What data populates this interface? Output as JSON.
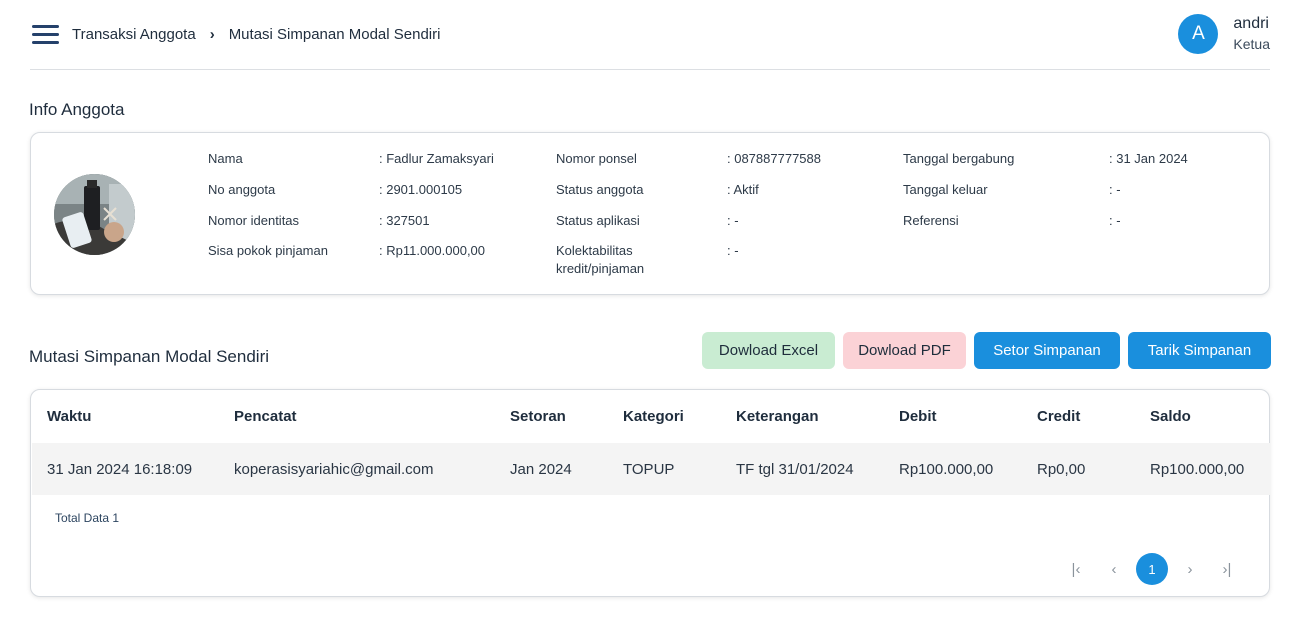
{
  "breadcrumb": {
    "parent": "Transaksi Anggota",
    "current": "Mutasi Simpanan Modal Sendiri"
  },
  "user": {
    "initial": "A",
    "name": "andri",
    "role": "Ketua"
  },
  "info": {
    "title": "Info Anggota",
    "fields": [
      {
        "label": "Nama",
        "value": ": Fadlur Zamaksyari"
      },
      {
        "label": "No anggota",
        "value": ": 2901.000105"
      },
      {
        "label": "Nomor identitas",
        "value": ": 327501"
      },
      {
        "label": "Sisa pokok pinjaman",
        "value": ": Rp11.000.000,00"
      },
      {
        "label": "Nomor ponsel",
        "value": ": 087887777588"
      },
      {
        "label": "Status anggota",
        "value": ": Aktif"
      },
      {
        "label": "Status aplikasi",
        "value": ": -"
      },
      {
        "label": "Kolektabilitas kredit/pinjaman",
        "value": ": -"
      },
      {
        "label": "Tanggal bergabung",
        "value": ": 31 Jan 2024"
      },
      {
        "label": "Tanggal keluar",
        "value": ": -"
      },
      {
        "label": "Referensi",
        "value": ": -"
      }
    ]
  },
  "mutasi": {
    "title": "Mutasi Simpanan Modal Sendiri",
    "buttons": {
      "excel": "Dowload Excel",
      "pdf": "Dowload PDF",
      "setor": "Setor Simpanan",
      "tarik": "Tarik Simpanan"
    },
    "columns": [
      "Waktu",
      "Pencatat",
      "Setoran",
      "Kategori",
      "Keterangan",
      "Debit",
      "Credit",
      "Saldo"
    ],
    "rows": [
      [
        "31 Jan 2024 16:18:09",
        "koperasisyariahic@gmail.com",
        "Jan 2024",
        "TOPUP",
        "TF tgl 31/01/2024",
        "Rp100.000,00",
        "Rp0,00",
        "Rp100.000,00"
      ]
    ],
    "total_label": "Total Data 1",
    "pagination": {
      "first": "|‹",
      "prev": "‹",
      "current": "1",
      "next": "›",
      "last": "›|"
    }
  },
  "colors": {
    "primary": "#1a8fdd",
    "excel_bg": "#c9ecd2",
    "pdf_bg": "#fbd2d6",
    "navy": "#25416b"
  }
}
